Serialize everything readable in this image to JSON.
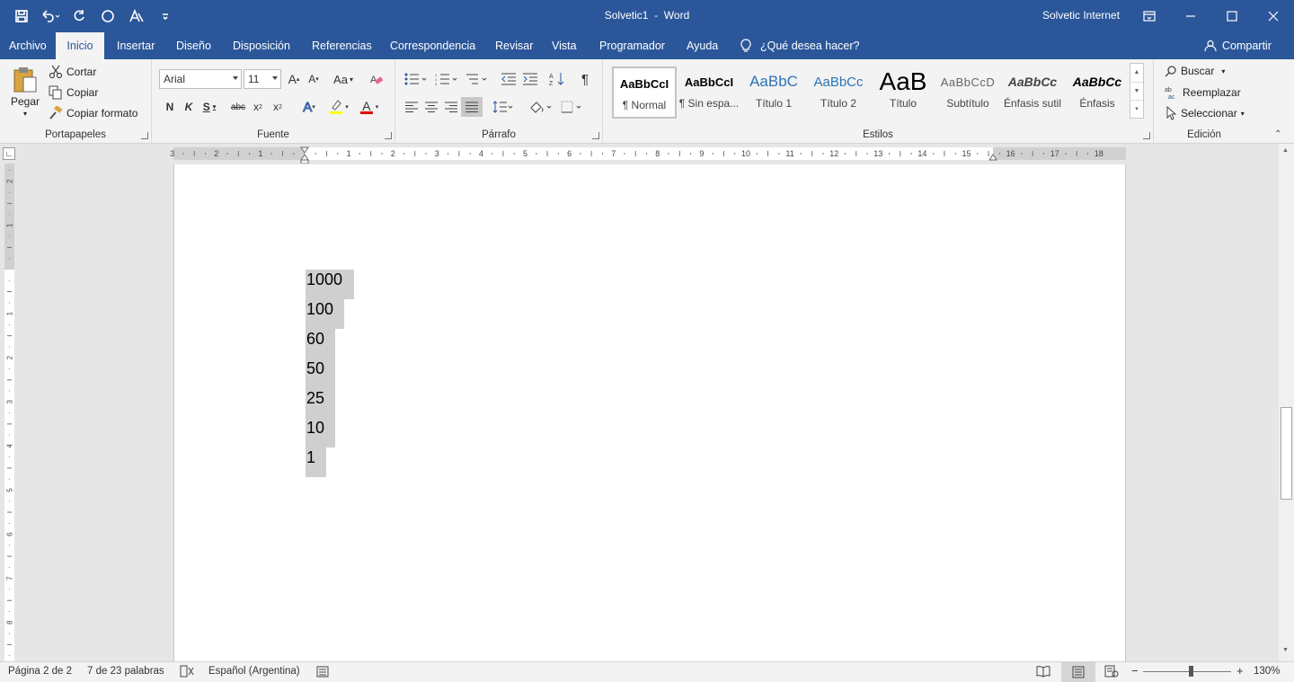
{
  "window": {
    "doc_title": "Solvetic1",
    "separator": "-",
    "app_name": "Word",
    "account": "Solvetic Internet"
  },
  "qat": {
    "icons": [
      "save-icon",
      "undo-icon",
      "redo-icon",
      "circle-icon",
      "font-style-icon",
      "customize-qat-icon"
    ]
  },
  "tabs": [
    "Archivo",
    "Inicio",
    "Insertar",
    "Diseño",
    "Disposición",
    "Referencias",
    "Correspondencia",
    "Revisar",
    "Vista",
    "Programador",
    "Ayuda"
  ],
  "active_tab": "Inicio",
  "tell_me": "¿Qué desea hacer?",
  "share": "Compartir",
  "clipboard": {
    "paste": "Pegar",
    "cut": "Cortar",
    "copy": "Copiar",
    "format_painter": "Copiar formato",
    "label": "Portapapeles"
  },
  "font": {
    "family": "Arial",
    "size": "11",
    "label": "Fuente",
    "case": "Aa",
    "bold": "N",
    "italic": "K",
    "underline": "S",
    "strike": "abc",
    "subscript": "x",
    "superscript": "x",
    "sub_mark": "2",
    "sup_mark": "2",
    "grow": "A",
    "shrink": "A",
    "clear": "A",
    "color": "A"
  },
  "paragraph": {
    "label": "Párrafo",
    "pilcrow": "¶"
  },
  "styles": {
    "label": "Estilos",
    "items": [
      {
        "preview": "AaBbCcI",
        "name": "¶ Normal"
      },
      {
        "preview": "AaBbCcI",
        "name": "¶ Sin espa..."
      },
      {
        "preview": "AaBbC",
        "name": "Título 1"
      },
      {
        "preview": "AaBbCc",
        "name": "Título 2"
      },
      {
        "preview": "AaB",
        "name": "Título"
      },
      {
        "preview": "AaBbCcD",
        "name": "Subtítulo"
      },
      {
        "preview": "AaBbCc",
        "name": "Énfasis sutil"
      },
      {
        "preview": "AaBbCc",
        "name": "Énfasis"
      }
    ]
  },
  "editing": {
    "find": "Buscar",
    "replace": "Reemplazar",
    "select": "Seleccionar",
    "label": "Edición"
  },
  "ruler": {
    "h_numbers": [
      "3",
      "2",
      "1",
      "1",
      "2",
      "3",
      "4",
      "5",
      "6",
      "7",
      "8",
      "9",
      "10",
      "11",
      "12",
      "13",
      "14",
      "15",
      "16",
      "17",
      "18"
    ],
    "v_numbers": [
      "2",
      "1",
      "1",
      "2",
      "3",
      "4",
      "5",
      "6",
      "7",
      "8"
    ]
  },
  "document": {
    "lines": [
      "1000",
      "100",
      "60",
      "50",
      "25",
      "10",
      "1"
    ]
  },
  "status": {
    "page": "Página 2 de 2",
    "words": "7 de 23 palabras",
    "language": "Español (Argentina)",
    "zoom": "130%"
  },
  "zoom_level": 130
}
